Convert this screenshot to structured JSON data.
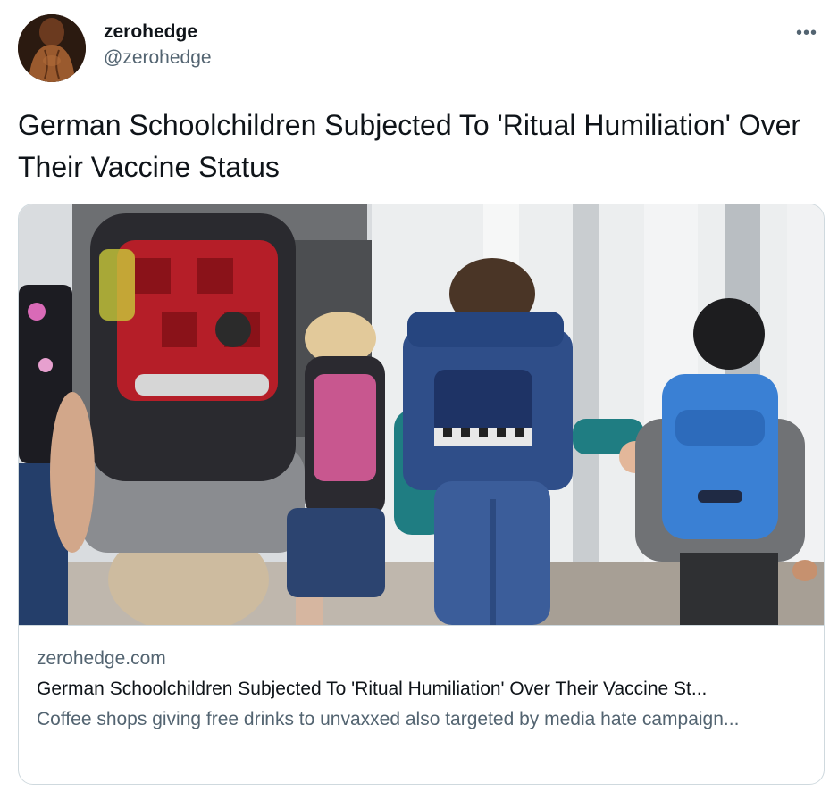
{
  "author": {
    "display_name": "zerohedge",
    "handle": "@zerohedge",
    "avatar_icon": "avatar-photo"
  },
  "menu": {
    "more_icon": "more-horizontal-icon",
    "more_label": "•••"
  },
  "tweet": {
    "text": "German Schoolchildren Subjected To 'Ritual Humiliation' Over Their Vaccine Status"
  },
  "card": {
    "domain": "zerohedge.com",
    "title": "German Schoolchildren Subjected To 'Ritual Humiliation' Over Their Vaccine St...",
    "description": "Coffee shops giving free drinks to unvaxxed also targeted by media hate campaign...",
    "image_icon": "children-with-backpacks-photo"
  },
  "colors": {
    "text_primary": "#0f1419",
    "text_secondary": "#536471",
    "border": "#cfd9de"
  }
}
